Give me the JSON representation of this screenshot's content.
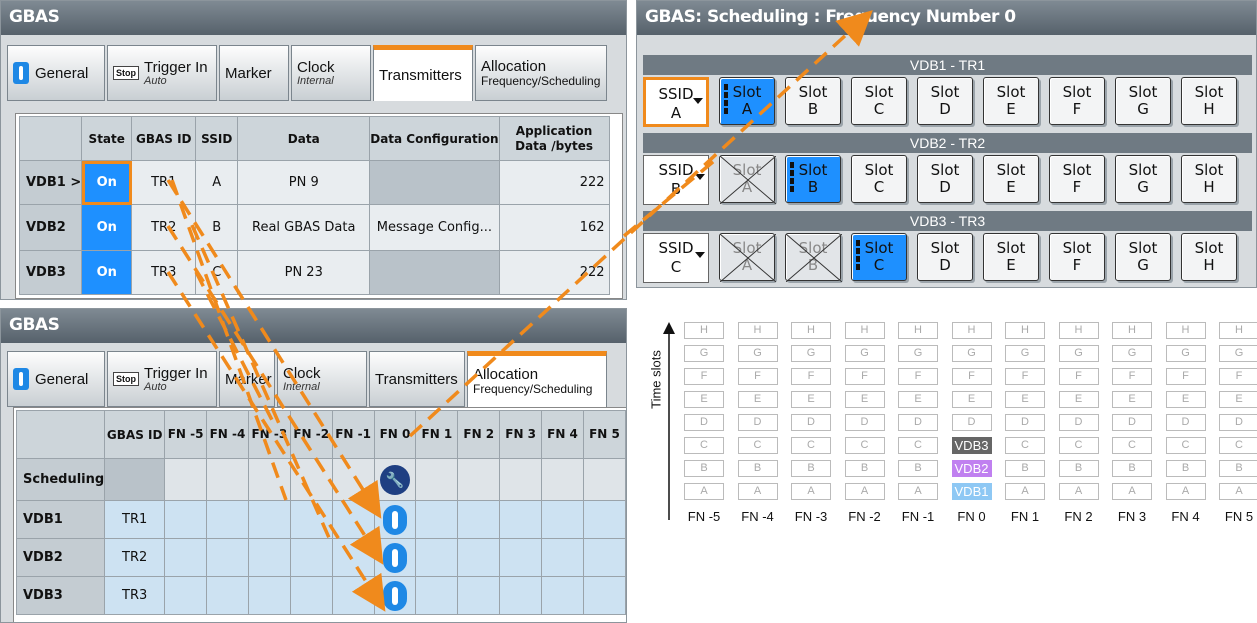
{
  "panel_transmitters": {
    "title": "GBAS",
    "tabs": [
      {
        "label": "General"
      },
      {
        "stop": "Stop",
        "label": "Trigger In",
        "sub": "Auto"
      },
      {
        "label": "Marker"
      },
      {
        "label": "Clock",
        "sub": "Internal"
      },
      {
        "label": "Transmitters"
      },
      {
        "label": "Allocation",
        "sub": "Frequency/Scheduling"
      }
    ],
    "headers": [
      "",
      "State",
      "GBAS ID",
      "SSID",
      "Data",
      "Data Configuration",
      "Application Data /bytes"
    ],
    "rows": [
      {
        "name": "VDB1 >",
        "state": "On",
        "id": "TR1",
        "ssid": "A",
        "data": "PN 9",
        "config": "",
        "bytes": "222"
      },
      {
        "name": "VDB2",
        "state": "On",
        "id": "TR2",
        "ssid": "B",
        "data": "Real GBAS Data",
        "config": "Message Config...",
        "bytes": "162"
      },
      {
        "name": "VDB3",
        "state": "On",
        "id": "TR3",
        "ssid": "C",
        "data": "PN 23",
        "config": "",
        "bytes": "222"
      }
    ]
  },
  "panel_allocation": {
    "title": "GBAS",
    "tabs": [
      {
        "label": "General"
      },
      {
        "stop": "Stop",
        "label": "Trigger In",
        "sub": "Auto"
      },
      {
        "label": "Marker"
      },
      {
        "label": "Clock",
        "sub": "Internal"
      },
      {
        "label": "Transmitters"
      },
      {
        "label": "Allocation",
        "sub": "Frequency/Scheduling"
      }
    ],
    "header_id": "GBAS ID",
    "fn_headers": [
      "FN -5",
      "FN -4",
      "FN -3",
      "FN -2",
      "FN -1",
      "FN 0",
      "FN 1",
      "FN 2",
      "FN 3",
      "FN 4",
      "FN 5"
    ],
    "rows": [
      {
        "name": "Scheduling",
        "id": ""
      },
      {
        "name": "VDB1",
        "id": "TR1"
      },
      {
        "name": "VDB2",
        "id": "TR2"
      },
      {
        "name": "VDB3",
        "id": "TR3"
      }
    ]
  },
  "panel_scheduling": {
    "title": "GBAS: Scheduling : Frequency Number 0",
    "bands": [
      {
        "label": "VDB1 - TR1",
        "ssid": "A",
        "selected": "A"
      },
      {
        "label": "VDB2 - TR2",
        "ssid": "B",
        "selected": "B"
      },
      {
        "label": "VDB3 - TR3",
        "ssid": "C",
        "selected": "C"
      }
    ],
    "ssid_label": "SSID",
    "slot_label": "Slot",
    "slot_letters": [
      "A",
      "B",
      "C",
      "D",
      "E",
      "F",
      "G",
      "H"
    ]
  },
  "chart_data": {
    "type": "table",
    "ylabel": "Time slots",
    "columns": [
      "FN -5",
      "FN -4",
      "FN -3",
      "FN -2",
      "FN -1",
      "FN 0",
      "FN 1",
      "FN 2",
      "FN 3",
      "FN 4",
      "FN 5"
    ],
    "rows_top_to_bottom": [
      "H",
      "G",
      "F",
      "E",
      "D",
      "C",
      "B",
      "A"
    ],
    "highlights": [
      {
        "column": "FN 0",
        "slot": "C",
        "label": "VDB3",
        "color": "#666666"
      },
      {
        "column": "FN 0",
        "slot": "B",
        "label": "VDB2",
        "color": "#c080f0"
      },
      {
        "column": "FN 0",
        "slot": "A",
        "label": "VDB1",
        "color": "#8ec8f4"
      }
    ]
  },
  "colors": {
    "accent": "#f08a1c",
    "on": "#1e90ff",
    "arrow": "#f08a1c"
  }
}
